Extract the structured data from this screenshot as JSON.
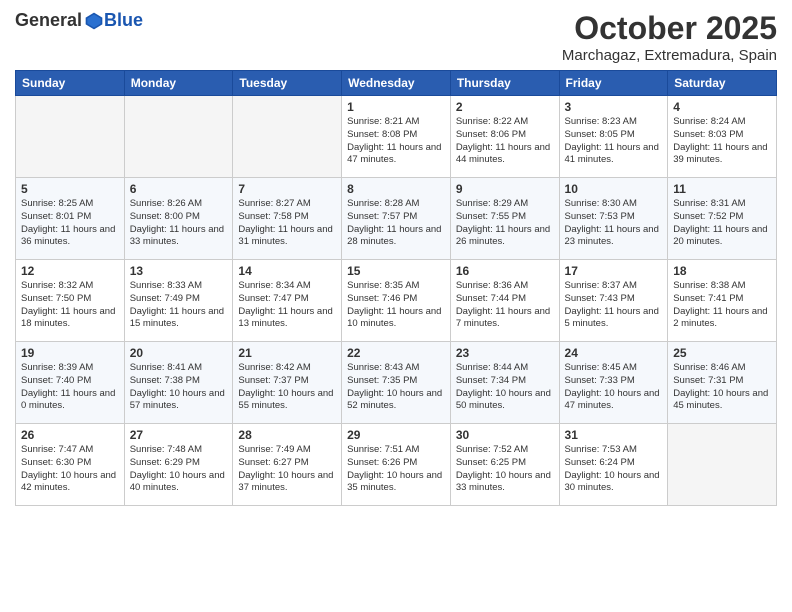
{
  "logo": {
    "text_general": "General",
    "text_blue": "Blue"
  },
  "header": {
    "month": "October 2025",
    "location": "Marchagaz, Extremadura, Spain"
  },
  "weekdays": [
    "Sunday",
    "Monday",
    "Tuesday",
    "Wednesday",
    "Thursday",
    "Friday",
    "Saturday"
  ],
  "weeks": [
    [
      {
        "day": "",
        "empty": true
      },
      {
        "day": "",
        "empty": true
      },
      {
        "day": "",
        "empty": true
      },
      {
        "day": "1",
        "sunrise": "8:21 AM",
        "sunset": "8:08 PM",
        "daylight": "11 hours and 47 minutes."
      },
      {
        "day": "2",
        "sunrise": "8:22 AM",
        "sunset": "8:06 PM",
        "daylight": "11 hours and 44 minutes."
      },
      {
        "day": "3",
        "sunrise": "8:23 AM",
        "sunset": "8:05 PM",
        "daylight": "11 hours and 41 minutes."
      },
      {
        "day": "4",
        "sunrise": "8:24 AM",
        "sunset": "8:03 PM",
        "daylight": "11 hours and 39 minutes."
      }
    ],
    [
      {
        "day": "5",
        "sunrise": "8:25 AM",
        "sunset": "8:01 PM",
        "daylight": "11 hours and 36 minutes."
      },
      {
        "day": "6",
        "sunrise": "8:26 AM",
        "sunset": "8:00 PM",
        "daylight": "11 hours and 33 minutes."
      },
      {
        "day": "7",
        "sunrise": "8:27 AM",
        "sunset": "7:58 PM",
        "daylight": "11 hours and 31 minutes."
      },
      {
        "day": "8",
        "sunrise": "8:28 AM",
        "sunset": "7:57 PM",
        "daylight": "11 hours and 28 minutes."
      },
      {
        "day": "9",
        "sunrise": "8:29 AM",
        "sunset": "7:55 PM",
        "daylight": "11 hours and 26 minutes."
      },
      {
        "day": "10",
        "sunrise": "8:30 AM",
        "sunset": "7:53 PM",
        "daylight": "11 hours and 23 minutes."
      },
      {
        "day": "11",
        "sunrise": "8:31 AM",
        "sunset": "7:52 PM",
        "daylight": "11 hours and 20 minutes."
      }
    ],
    [
      {
        "day": "12",
        "sunrise": "8:32 AM",
        "sunset": "7:50 PM",
        "daylight": "11 hours and 18 minutes."
      },
      {
        "day": "13",
        "sunrise": "8:33 AM",
        "sunset": "7:49 PM",
        "daylight": "11 hours and 15 minutes."
      },
      {
        "day": "14",
        "sunrise": "8:34 AM",
        "sunset": "7:47 PM",
        "daylight": "11 hours and 13 minutes."
      },
      {
        "day": "15",
        "sunrise": "8:35 AM",
        "sunset": "7:46 PM",
        "daylight": "11 hours and 10 minutes."
      },
      {
        "day": "16",
        "sunrise": "8:36 AM",
        "sunset": "7:44 PM",
        "daylight": "11 hours and 7 minutes."
      },
      {
        "day": "17",
        "sunrise": "8:37 AM",
        "sunset": "7:43 PM",
        "daylight": "11 hours and 5 minutes."
      },
      {
        "day": "18",
        "sunrise": "8:38 AM",
        "sunset": "7:41 PM",
        "daylight": "11 hours and 2 minutes."
      }
    ],
    [
      {
        "day": "19",
        "sunrise": "8:39 AM",
        "sunset": "7:40 PM",
        "daylight": "11 hours and 0 minutes."
      },
      {
        "day": "20",
        "sunrise": "8:41 AM",
        "sunset": "7:38 PM",
        "daylight": "10 hours and 57 minutes."
      },
      {
        "day": "21",
        "sunrise": "8:42 AM",
        "sunset": "7:37 PM",
        "daylight": "10 hours and 55 minutes."
      },
      {
        "day": "22",
        "sunrise": "8:43 AM",
        "sunset": "7:35 PM",
        "daylight": "10 hours and 52 minutes."
      },
      {
        "day": "23",
        "sunrise": "8:44 AM",
        "sunset": "7:34 PM",
        "daylight": "10 hours and 50 minutes."
      },
      {
        "day": "24",
        "sunrise": "8:45 AM",
        "sunset": "7:33 PM",
        "daylight": "10 hours and 47 minutes."
      },
      {
        "day": "25",
        "sunrise": "8:46 AM",
        "sunset": "7:31 PM",
        "daylight": "10 hours and 45 minutes."
      }
    ],
    [
      {
        "day": "26",
        "sunrise": "7:47 AM",
        "sunset": "6:30 PM",
        "daylight": "10 hours and 42 minutes."
      },
      {
        "day": "27",
        "sunrise": "7:48 AM",
        "sunset": "6:29 PM",
        "daylight": "10 hours and 40 minutes."
      },
      {
        "day": "28",
        "sunrise": "7:49 AM",
        "sunset": "6:27 PM",
        "daylight": "10 hours and 37 minutes."
      },
      {
        "day": "29",
        "sunrise": "7:51 AM",
        "sunset": "6:26 PM",
        "daylight": "10 hours and 35 minutes."
      },
      {
        "day": "30",
        "sunrise": "7:52 AM",
        "sunset": "6:25 PM",
        "daylight": "10 hours and 33 minutes."
      },
      {
        "day": "31",
        "sunrise": "7:53 AM",
        "sunset": "6:24 PM",
        "daylight": "10 hours and 30 minutes."
      },
      {
        "day": "",
        "empty": true
      }
    ]
  ]
}
